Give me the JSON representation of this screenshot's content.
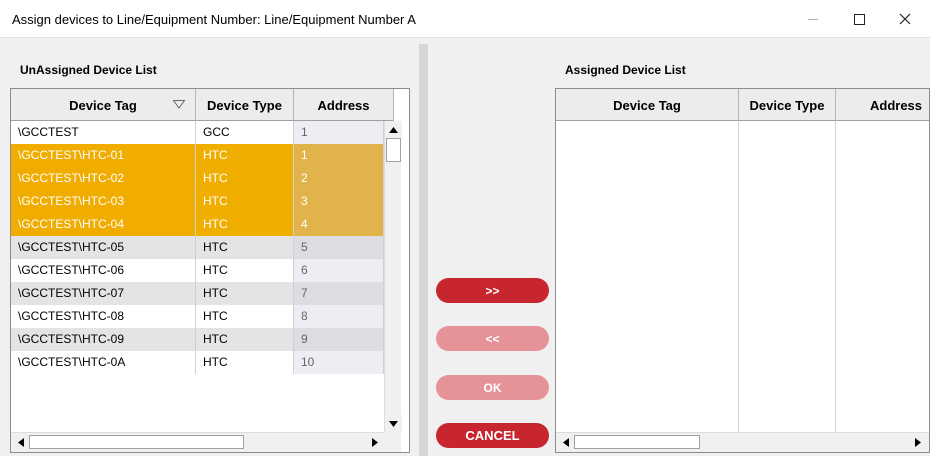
{
  "window": {
    "title": "Assign devices to Line/Equipment Number: Line/Equipment Number A"
  },
  "unassigned": {
    "label": "UnAssigned Device List",
    "columns": [
      "Device Tag",
      "Device Type",
      "Address"
    ],
    "rows": [
      {
        "tag": "\\GCCTEST",
        "type": "GCC",
        "address": "1",
        "selected": false
      },
      {
        "tag": "\\GCCTEST\\HTC-01",
        "type": "HTC",
        "address": "1",
        "selected": true
      },
      {
        "tag": "\\GCCTEST\\HTC-02",
        "type": "HTC",
        "address": "2",
        "selected": true
      },
      {
        "tag": "\\GCCTEST\\HTC-03",
        "type": "HTC",
        "address": "3",
        "selected": true
      },
      {
        "tag": "\\GCCTEST\\HTC-04",
        "type": "HTC",
        "address": "4",
        "selected": true
      },
      {
        "tag": "\\GCCTEST\\HTC-05",
        "type": "HTC",
        "address": "5",
        "selected": false
      },
      {
        "tag": "\\GCCTEST\\HTC-06",
        "type": "HTC",
        "address": "6",
        "selected": false
      },
      {
        "tag": "\\GCCTEST\\HTC-07",
        "type": "HTC",
        "address": "7",
        "selected": false
      },
      {
        "tag": "\\GCCTEST\\HTC-08",
        "type": "HTC",
        "address": "8",
        "selected": false
      },
      {
        "tag": "\\GCCTEST\\HTC-09",
        "type": "HTC",
        "address": "9",
        "selected": false
      },
      {
        "tag": "\\GCCTEST\\HTC-0A",
        "type": "HTC",
        "address": "10",
        "selected": false
      }
    ]
  },
  "assigned": {
    "label": "Assigned Device List",
    "columns": [
      "Device Tag",
      "Device Type",
      "Address"
    ]
  },
  "buttons": {
    "assign": ">>",
    "unassign": "<<",
    "ok": "OK",
    "cancel": "CANCEL"
  },
  "colors": {
    "selection": "#efae00",
    "button_active": "#c8262e",
    "button_disabled": "#e59398"
  },
  "icons": {
    "sort": "sort-descending-icon",
    "minimize": "minimize-icon",
    "maximize": "maximize-icon",
    "close": "close-icon"
  }
}
